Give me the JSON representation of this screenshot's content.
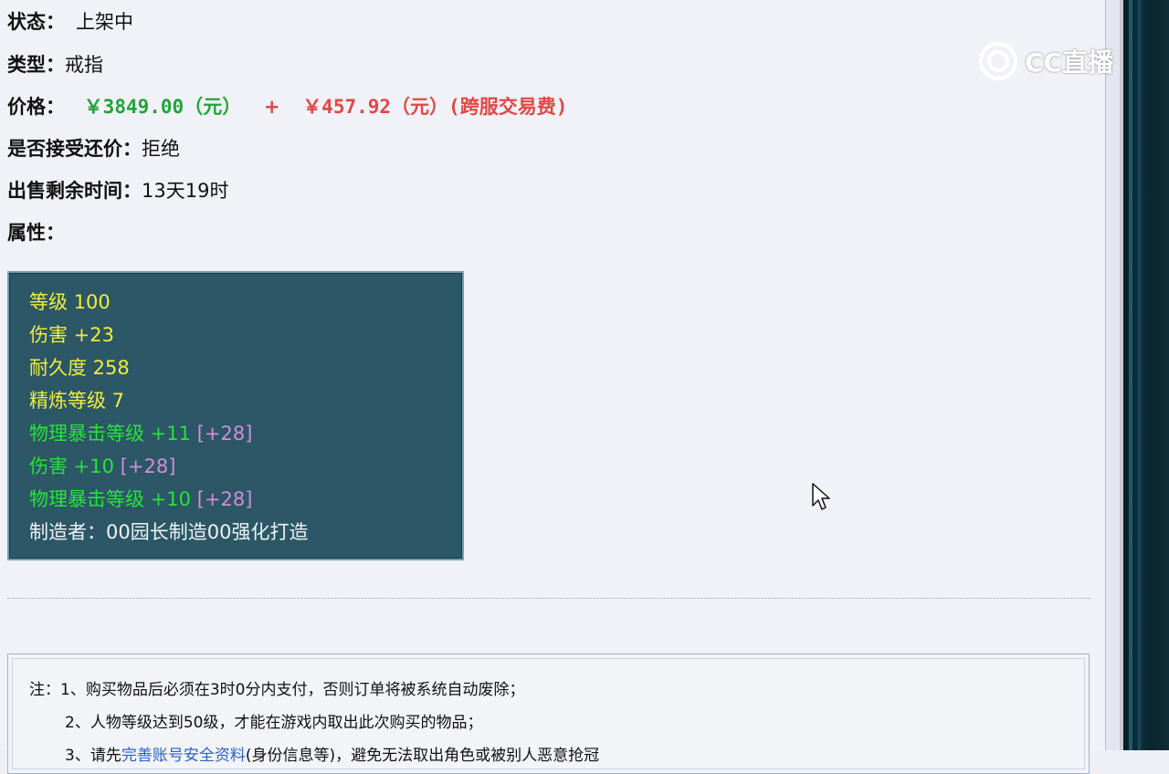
{
  "item": {
    "status_label": "状态：",
    "status_value": "上架中",
    "type_label": "类型：",
    "type_value": "戒指",
    "price_label": "价格：",
    "price_main": "￥3849.00（元）",
    "price_plus": "+",
    "price_fee": "￥457.92（元）(跨服交易费)",
    "bargain_label": "是否接受还价：",
    "bargain_value": "拒绝",
    "remaining_label": "出售剩余时间：",
    "remaining_value": "13天19时",
    "attributes_label": "属性："
  },
  "attributes": {
    "level": "等级 100",
    "damage": "伤害 +23",
    "durability": "耐久度 258",
    "refine": "精炼等级 7",
    "crit1": "物理暴击等级 +11",
    "crit1_bonus": "[+28]",
    "damage2": "伤害 +10",
    "damage2_bonus": "[+28]",
    "crit2": "物理暴击等级 +10",
    "crit2_bonus": "[+28]",
    "maker": "制造者：00园长制造00强化打造"
  },
  "notes": {
    "line1": "注：1、购买物品后必须在3时0分内支付，否则订单将被系统自动废除；",
    "line2": "2、人物等级达到50级，才能在游戏内取出此次购买的物品；",
    "line3_prefix": "3、请先",
    "line3_link": "完善账号安全资料",
    "line3_suffix": "(身份信息等)，避免无法取出角色或被别人恶意抢冠"
  },
  "overlay": {
    "logo_text": "CC直播"
  },
  "colors": {
    "attr_bg": "#2c5766",
    "yellow": "#eeee3c",
    "green": "#27e23c",
    "pink": "#d58bd9",
    "price_green": "#22a43a",
    "price_red": "#e44646",
    "link": "#2b62c8"
  }
}
